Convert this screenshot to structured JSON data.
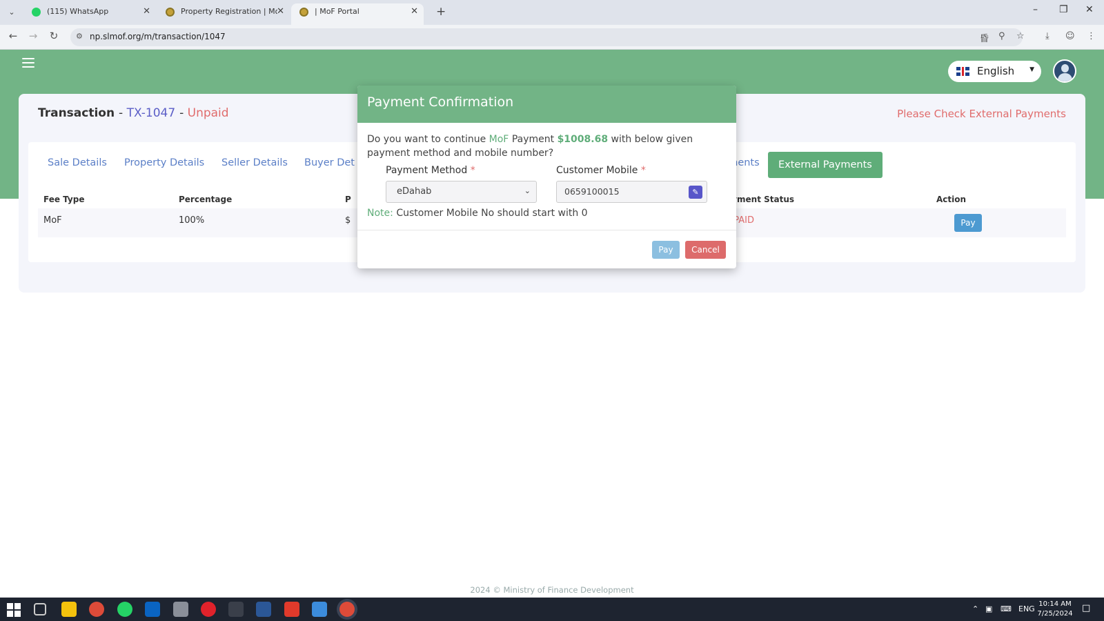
{
  "browser": {
    "tabs": [
      {
        "label": "(115) WhatsApp"
      },
      {
        "label": "Property Registration | MoF Por"
      },
      {
        "label": "| MoF Portal"
      }
    ],
    "url": "np.slmof.org/m/transaction/1047"
  },
  "header": {
    "language": "English"
  },
  "transaction": {
    "label": "Transaction",
    "id": "TX-1047",
    "status": "Unpaid",
    "warning": "Please Check External Payments"
  },
  "tabs": [
    {
      "label": "Sale Details"
    },
    {
      "label": "Property Details"
    },
    {
      "label": "Seller Details"
    },
    {
      "label": "Buyer Det"
    },
    {
      "label": "uments"
    },
    {
      "label": "External Payments"
    }
  ],
  "table": {
    "headers": [
      "Fee Type",
      "Percentage",
      "P",
      "Payment Status",
      "Action"
    ],
    "rows": [
      {
        "fee_type": "MoF",
        "percentage": "100%",
        "amount": "$",
        "status": "UNPAID",
        "action": "Pay"
      }
    ]
  },
  "modal": {
    "title": "Payment Confirmation",
    "question_prefix": "Do you want to continue",
    "question_fee": "MoF",
    "question_payment": "Payment",
    "question_amount": "$1008.68",
    "question_suffix": "with below given payment method and mobile number?",
    "payment_method_label": "Payment Method",
    "payment_method_value": "eDahab",
    "mobile_label": "Customer Mobile",
    "mobile_value": "0659100015",
    "required_mark": "*",
    "note_label": "Note:",
    "note_text": "Customer Mobile No should start with 0",
    "pay_label": "Pay",
    "cancel_label": "Cancel"
  },
  "footer": {
    "text": "2024 © Ministry of Finance Development"
  },
  "taskbar": {
    "lang": "ENG",
    "time": "10:14 AM",
    "date": "7/25/2024"
  },
  "colors": {
    "brand_green": "#72b486",
    "active_tab_green": "#5fad79",
    "link_blue": "#5b7fc7",
    "danger_red": "#e06c6c",
    "pay_blue": "#4d9ad1"
  }
}
